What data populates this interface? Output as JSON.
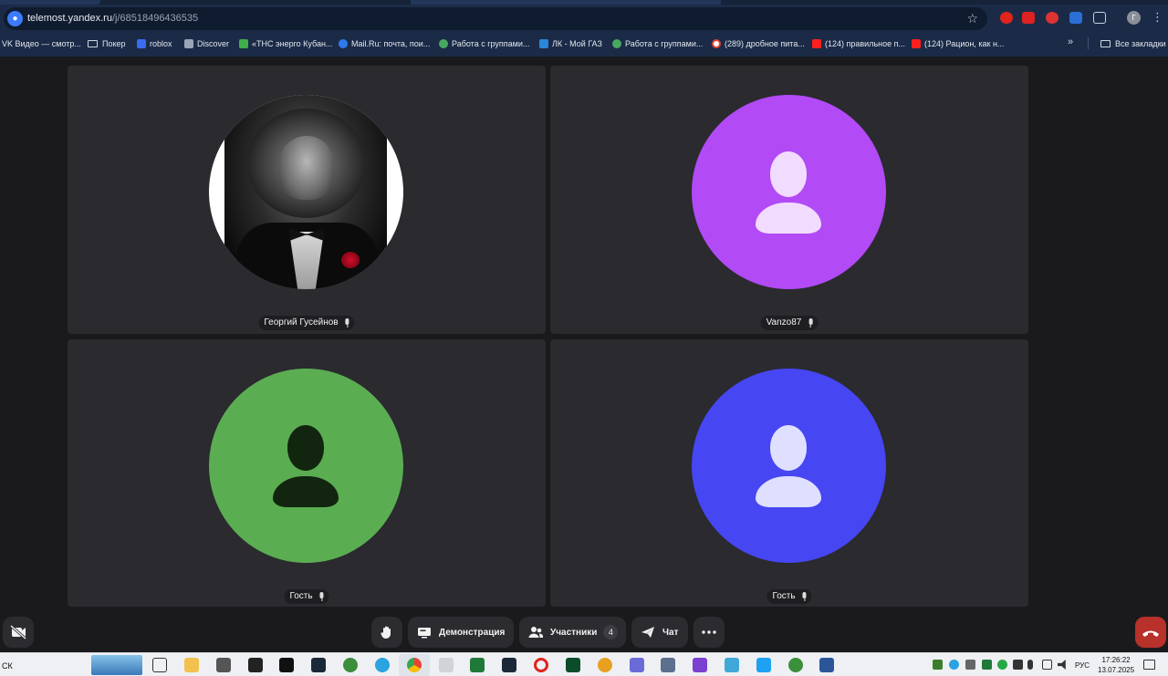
{
  "browser": {
    "url_host": "telemost.yandex.ru",
    "url_path": "/j/68518496436535",
    "bookmarks": [
      "VK Видео — смотр...",
      "Покер",
      "roblox",
      "Discover",
      "«ТНС энерго Кубан...",
      "Mail.Ru: почта, пои...",
      "Работа с группами...",
      "ЛК - Мой ГАЗ",
      "Работа с группами...",
      "(289) дробное пита...",
      "(124) правильное п...",
      "(124) Рацион, как н..."
    ],
    "all_bookmarks_label": "Все закладки",
    "profile_initial": "Г"
  },
  "participants": [
    {
      "name": "Георгий Гусейнов",
      "avatar": "photo"
    },
    {
      "name": "Vanzo87",
      "avatar_color": "#b24af5"
    },
    {
      "name": "Гость",
      "avatar_color": "#5bad52"
    },
    {
      "name": "Гость",
      "avatar_color": "#4646f2"
    }
  ],
  "controls": {
    "demo_label": "Демонстрация",
    "participants_label": "Участники",
    "participants_count": "4",
    "chat_label": "Чат"
  },
  "taskbar": {
    "start_text": "СК",
    "lang": "РУС",
    "time": "17:26:22",
    "date": "13.07.2025"
  },
  "colors": {
    "page_bg": "#1a1a1c",
    "tile_bg": "#2a2a2f",
    "hangup": "#b8312a",
    "browser_bar": "#1b2b47"
  }
}
